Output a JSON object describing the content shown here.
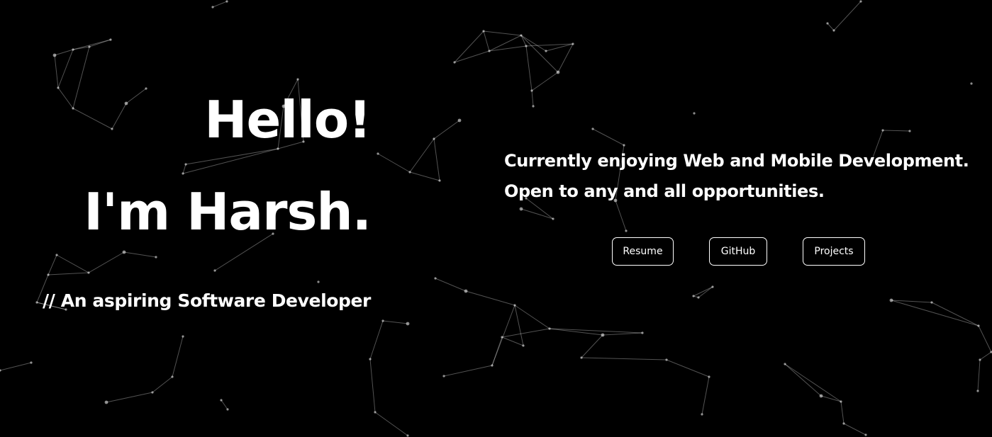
{
  "hero": {
    "greeting": "Hello!",
    "name_line": "I'm Harsh.",
    "tagline": "// An aspiring Software Developer"
  },
  "intro": {
    "line1": "Currently enjoying Web and Mobile Development.",
    "line2": "Open to any and all opportunities."
  },
  "buttons": {
    "resume": "Resume",
    "github": "GitHub",
    "projects": "Projects"
  },
  "colors": {
    "background": "#000000",
    "text": "#ffffff",
    "particles": "#ffffff"
  }
}
